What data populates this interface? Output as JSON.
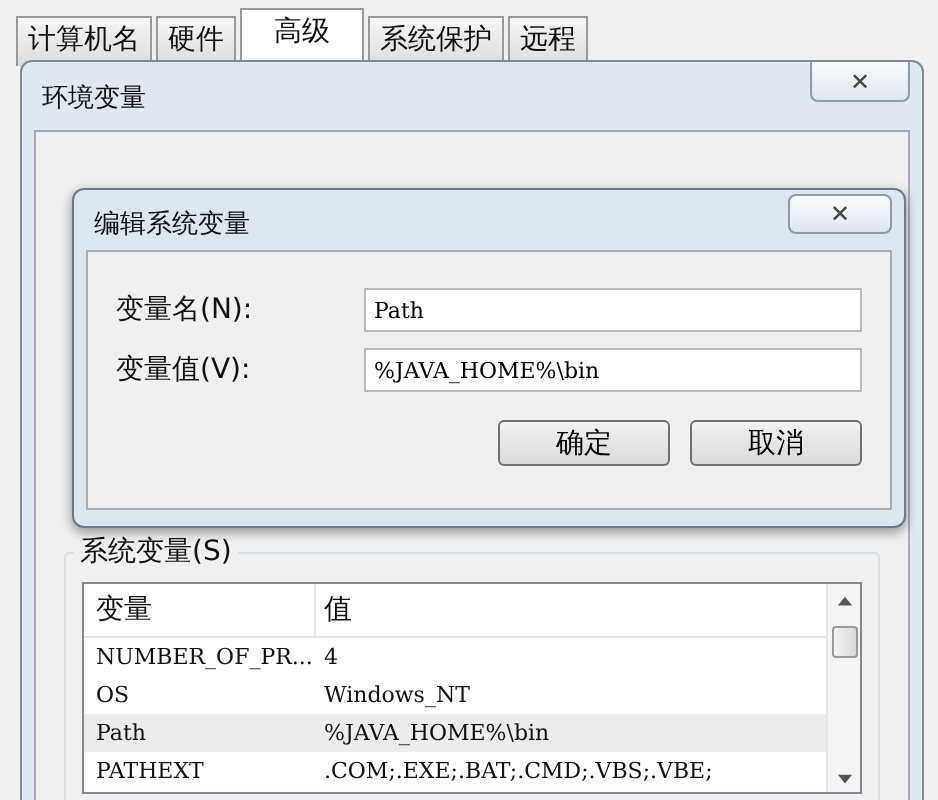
{
  "tabs": [
    {
      "label": "计算机名",
      "selected": false
    },
    {
      "label": "硬件",
      "selected": false
    },
    {
      "label": "高级",
      "selected": true
    },
    {
      "label": "系统保护",
      "selected": false
    },
    {
      "label": "远程",
      "selected": false
    }
  ],
  "env_window": {
    "title": "环境变量",
    "close": "✕",
    "system_group": {
      "label": "系统变量(S)",
      "columns": [
        "变量",
        "值"
      ],
      "rows": [
        {
          "name": "NUMBER_OF_PR...",
          "value": "4",
          "selected": false
        },
        {
          "name": "OS",
          "value": "Windows_NT",
          "selected": false
        },
        {
          "name": "Path",
          "value": "%JAVA_HOME%\\bin",
          "selected": true
        },
        {
          "name": "PATHEXT",
          "value": ".COM;.EXE;.BAT;.CMD;.VBS;.VBE;",
          "selected": false
        }
      ]
    }
  },
  "edit_dialog": {
    "title": "编辑系统变量",
    "close": "✕",
    "fields": [
      {
        "label": "变量名(N):",
        "value": "Path"
      },
      {
        "label": "变量值(V):",
        "value": "%JAVA_HOME%\\bin"
      }
    ],
    "buttons": [
      "确定",
      "取消"
    ]
  }
}
